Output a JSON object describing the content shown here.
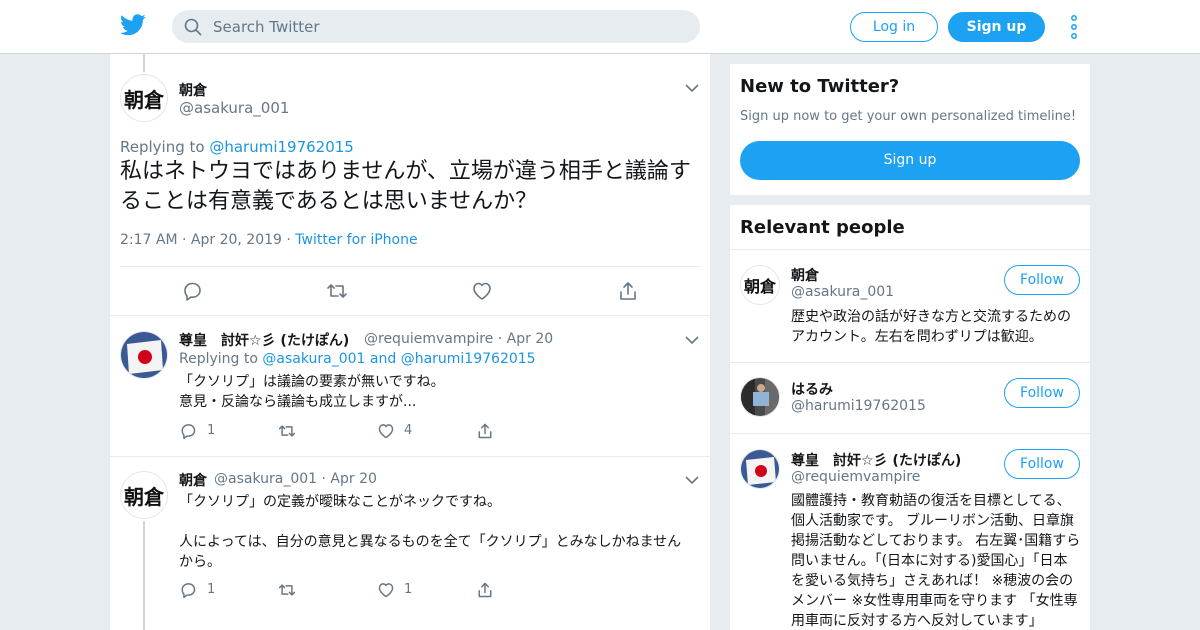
{
  "header": {
    "search_placeholder": "Search Twitter",
    "login_label": "Log in",
    "signup_label": "Sign up"
  },
  "focused_tweet": {
    "avatar_text": "朝倉",
    "name": "朝倉",
    "handle": "@asakura_001",
    "replying_prefix": "Replying to ",
    "replying_to": "@harumi19762015",
    "text": "私はネトウヨではありませんが、立場が違う相手と議論することは有意義であるとは思いませんか？",
    "time": "2:17 AM",
    "sep": "·",
    "date": "Apr 20, 2019",
    "source": "Twitter for iPhone"
  },
  "replies": [
    {
      "name": "尊皇　討奸☆彡 (たけぽん)",
      "handle": "@requiemvampire",
      "sep": "·",
      "date": "Apr 20",
      "replying_prefix": "Replying to ",
      "replying_to_1": "@asakura_001",
      "replying_and": " and ",
      "replying_to_2": "@harumi19762015",
      "line1": "「クソリプ」は議論の要素が無いですね。",
      "line2": "意見・反論なら議論も成立しますが...",
      "reply_count": "1",
      "retweet_count": "",
      "like_count": "4"
    },
    {
      "avatar_text": "朝倉",
      "name": "朝倉",
      "handle": "@asakura_001",
      "sep": "·",
      "date": "Apr 20",
      "line1": "「クソリプ」の定義が曖昧なことがネックですね。",
      "line2": "人によっては、自分の意見と異なるものを全て「クソリプ」とみなしかねませんから。",
      "reply_count": "1",
      "retweet_count": "",
      "like_count": "1"
    }
  ],
  "sidebar": {
    "new_card": {
      "title": "New to Twitter?",
      "subtitle": "Sign up now to get your own personalized timeline!",
      "signup_label": "Sign up"
    },
    "relevant": {
      "title": "Relevant people",
      "follow_label": "Follow",
      "people": [
        {
          "avatar_text": "朝倉",
          "name": "朝倉",
          "handle": "@asakura_001",
          "bio": "歴史や政治の話が好きな方と交流するためのアカウント。左右を問わずリプは歓迎。"
        },
        {
          "name": "はるみ",
          "handle": "@harumi19762015",
          "bio": ""
        },
        {
          "name": "尊皇　討奸☆彡 (たけぽん)",
          "handle": "@requiemvampire",
          "bio": "國體護持・教育勅語の復活を目標としてる、個人活動家です。 ブルーリボン活動、日章旗掲揚活動などしております。 右左翼･国籍すら問いません。「(日本に対する)愛国心」「日本を愛いる気持ち」さえあれば！ ※穂波の会のメンバー ※女性専用車両を守ります 「女性専用車両に反対する方へ反対しています」"
        }
      ]
    }
  },
  "colors": {
    "accent": "#1da1f2",
    "link": "#1b95e0",
    "muted": "#657786",
    "background": "#e6ecf0"
  }
}
